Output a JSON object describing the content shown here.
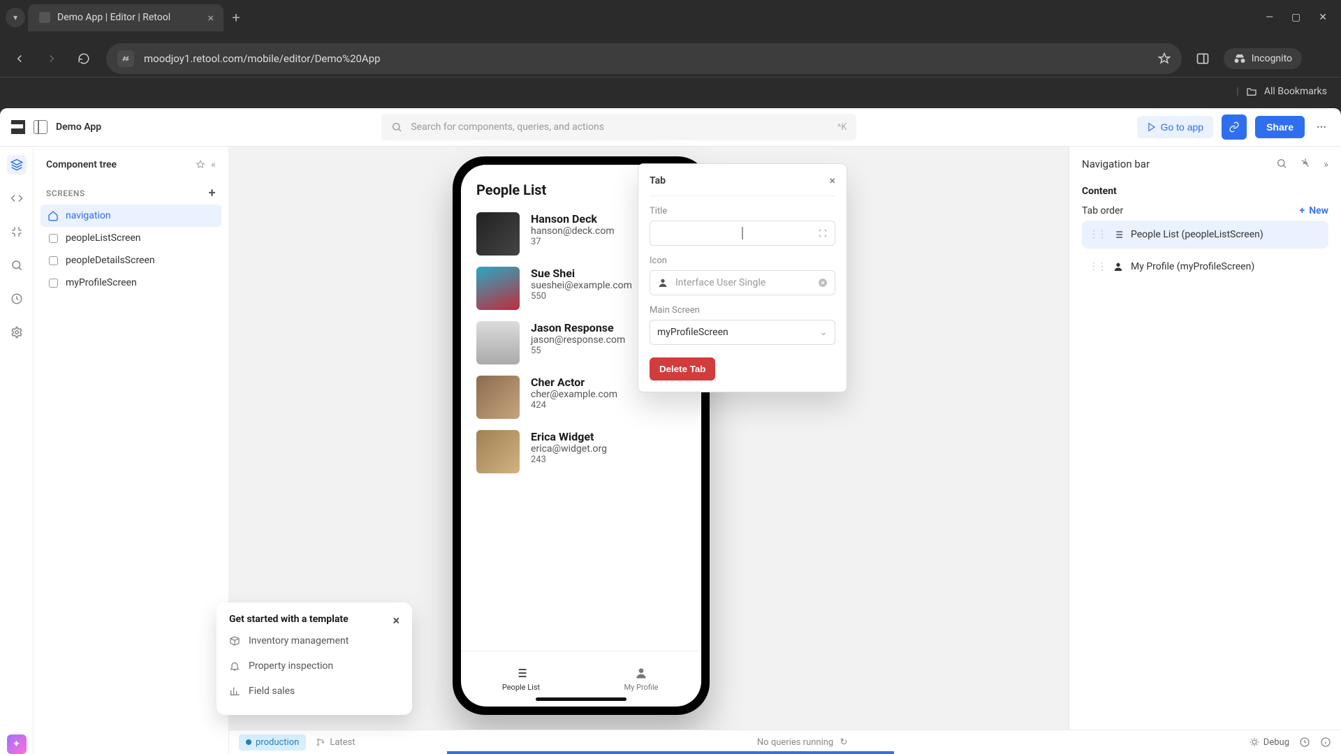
{
  "browser": {
    "tab_title": "Demo App | Editor | Retool",
    "url": "moodjoy1.retool.com/mobile/editor/Demo%20App",
    "incognito": "Incognito",
    "all_bookmarks": "All Bookmarks"
  },
  "topbar": {
    "app_title": "Demo App",
    "search_placeholder": "Search for components, queries, and actions",
    "search_shortcut": "^K",
    "goto_app": "Go to app",
    "share": "Share"
  },
  "left": {
    "heading": "Component tree",
    "screens_label": "SCREENS",
    "items": [
      {
        "label": "navigation",
        "kind": "home"
      },
      {
        "label": "peopleListScreen",
        "kind": "square"
      },
      {
        "label": "peopleDetailsScreen",
        "kind": "square"
      },
      {
        "label": "myProfileScreen",
        "kind": "square"
      }
    ]
  },
  "phone": {
    "header": "People List",
    "people": [
      {
        "name": "Hanson Deck",
        "email": "hanson@deck.com",
        "num": "37"
      },
      {
        "name": "Sue Shei",
        "email": "sueshei@example.com",
        "num": "550"
      },
      {
        "name": "Jason Response",
        "email": "jason@response.com",
        "num": "55"
      },
      {
        "name": "Cher Actor",
        "email": "cher@example.com",
        "num": "424"
      },
      {
        "name": "Erica Widget",
        "email": "erica@widget.org",
        "num": "243"
      }
    ],
    "tabs": [
      {
        "label": "People List"
      },
      {
        "label": "My Profile"
      }
    ]
  },
  "tab_popup": {
    "heading": "Tab",
    "field_title": "Title",
    "field_icon": "Icon",
    "icon_value": "Interface User Single",
    "field_main": "Main Screen",
    "main_value": "myProfileScreen",
    "delete": "Delete Tab"
  },
  "right_panel": {
    "title": "Navigation bar",
    "content": "Content",
    "tab_order": "Tab order",
    "new": "New",
    "items": [
      {
        "label": "People List (peopleListScreen)",
        "icon": "list"
      },
      {
        "label": "My Profile (myProfileScreen)",
        "icon": "user"
      }
    ]
  },
  "templates": {
    "heading": "Get started with a template",
    "items": [
      "Inventory management",
      "Property inspection",
      "Field sales"
    ]
  },
  "footer": {
    "env": "production",
    "latest": "Latest",
    "queries": "No queries running",
    "debug": "Debug"
  }
}
